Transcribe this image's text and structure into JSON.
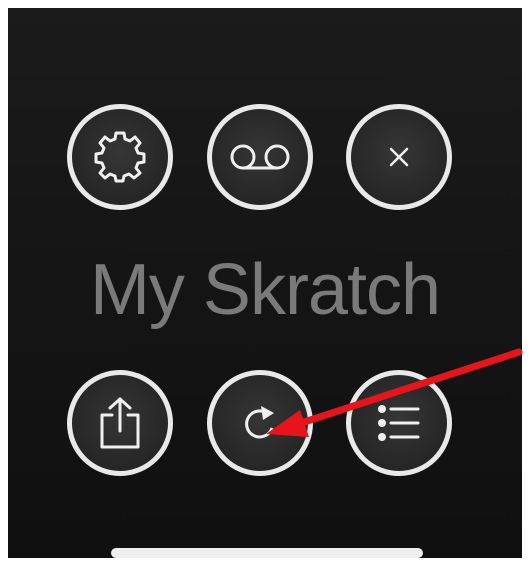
{
  "app": {
    "title": "My Skratch"
  },
  "top_buttons": [
    {
      "name": "settings",
      "icon": "gear-icon"
    },
    {
      "name": "voicemail",
      "icon": "voicemail-icon"
    },
    {
      "name": "close",
      "icon": "close-icon",
      "glyph": "×"
    }
  ],
  "bottom_buttons": [
    {
      "name": "share",
      "icon": "share-icon"
    },
    {
      "name": "refresh",
      "icon": "refresh-icon"
    },
    {
      "name": "list",
      "icon": "list-icon"
    }
  ],
  "colors": {
    "background": "#151515",
    "button_ring": "#e9e9e9",
    "title": "#7a7a7a",
    "annotation_arrow": "#e8141b"
  }
}
